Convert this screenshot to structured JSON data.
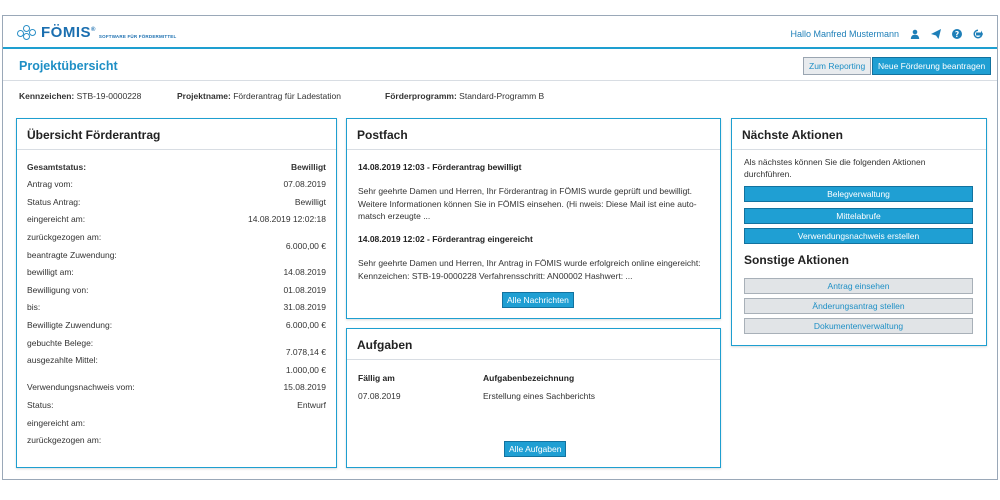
{
  "brand": {
    "name": "FÖMIS",
    "reg": "®",
    "tagline": "SOFTWARE FÜR FÖRDERMITTEL"
  },
  "user": {
    "greeting": "Hallo Manfred Mustermann"
  },
  "header": {
    "title": "Projektübersicht",
    "reporting_label": "Zum Reporting",
    "new_funding_label": "Neue Förderung beantragen"
  },
  "meta": {
    "kennzeichen_label": "Kennzeichen:",
    "kennzeichen": "STB-19-0000228",
    "projektname_label": "Projektname:",
    "projektname": "Förderantrag für Ladestation",
    "programm_label": "Förderprogramm:",
    "programm": "Standard-Programm B"
  },
  "overview": {
    "title": "Übersicht Förderantrag",
    "rows": [
      {
        "k": "Gesamtstatus:",
        "v": "Bewilligt"
      },
      {
        "k": "Antrag vom:",
        "v": "07.08.2019"
      },
      {
        "k": "Status Antrag:",
        "v": "Bewilligt"
      },
      {
        "k": "eingereicht am:",
        "v": "14.08.2019 12:02:18"
      },
      {
        "k": "zurückgezogen am:",
        "v": ""
      },
      {
        "k": "",
        "v": "6.000,00 €"
      },
      {
        "k": "beantragte Zuwendung:",
        "v": ""
      },
      {
        "k": "bewilligt am:",
        "v": "14.08.2019"
      },
      {
        "k": "Bewilligung von:",
        "v": "01.08.2019"
      },
      {
        "k": "bis:",
        "v": "31.08.2019"
      },
      {
        "k": "Bewilligte Zuwendung:",
        "v": "6.000,00 €"
      },
      {
        "k": "gebuchte Belege:",
        "v": ""
      },
      {
        "k": "",
        "v": "7.078,14 €"
      },
      {
        "k": "ausgezahlte Mittel:",
        "v": ""
      },
      {
        "k": "",
        "v": "1.000,00 €"
      },
      {
        "k": "Verwendungsnachweis vom:",
        "v": "15.08.2019"
      },
      {
        "k": "Status:",
        "v": "Entwurf"
      },
      {
        "k": "eingereicht am:",
        "v": ""
      },
      {
        "k": "zurückgezogen am:",
        "v": ""
      }
    ]
  },
  "postfach": {
    "title": "Postfach",
    "messages": [
      {
        "subject": "14.08.2019 12:03 - Förderantrag bewilligt",
        "body": "Sehr geehrte Damen und Herren, Ihr Förderantrag in FÖMIS wurde geprüft und bewilligt. Weitere Informationen können Sie in FÖMIS einsehen. (Hi nweis: Diese Mail ist eine auto-matsch erzeugte ..."
      },
      {
        "subject": "14.08.2019 12:02 - Förderantrag eingereicht",
        "body": "Sehr geehrte Damen und Herren, Ihr Antrag in FÖMIS wurde erfolgreich online eingereicht: Kennzeichen: STB-19-0000228 Verfahrensschritt: AN00002 Hashwert: ..."
      }
    ],
    "all_label": "Alle Nachrichten"
  },
  "tasks": {
    "title": "Aufgaben",
    "col_due": "Fällig am",
    "col_name": "Aufgabenbezeichnung",
    "rows": [
      {
        "due": "07.08.2019",
        "name": "Erstellung eines Sachberichts"
      }
    ],
    "all_label": "Alle Aufgaben"
  },
  "actions": {
    "title": "Nächste Aktionen",
    "intro": "Als nächstes können Sie die folgenden Aktionen durchführen.",
    "primary": [
      "Belegverwaltung",
      "Mittelabrufe",
      "Verwendungsnachweis erstellen"
    ],
    "other_title": "Sonstige Aktionen",
    "secondary": [
      "Antrag einsehen",
      "Änderungsantrag stellen",
      "Dokumentenverwaltung"
    ]
  },
  "colors": {
    "accent": "#1f9fd3",
    "title": "#1e8fc5",
    "border": "#1e9fd0"
  }
}
